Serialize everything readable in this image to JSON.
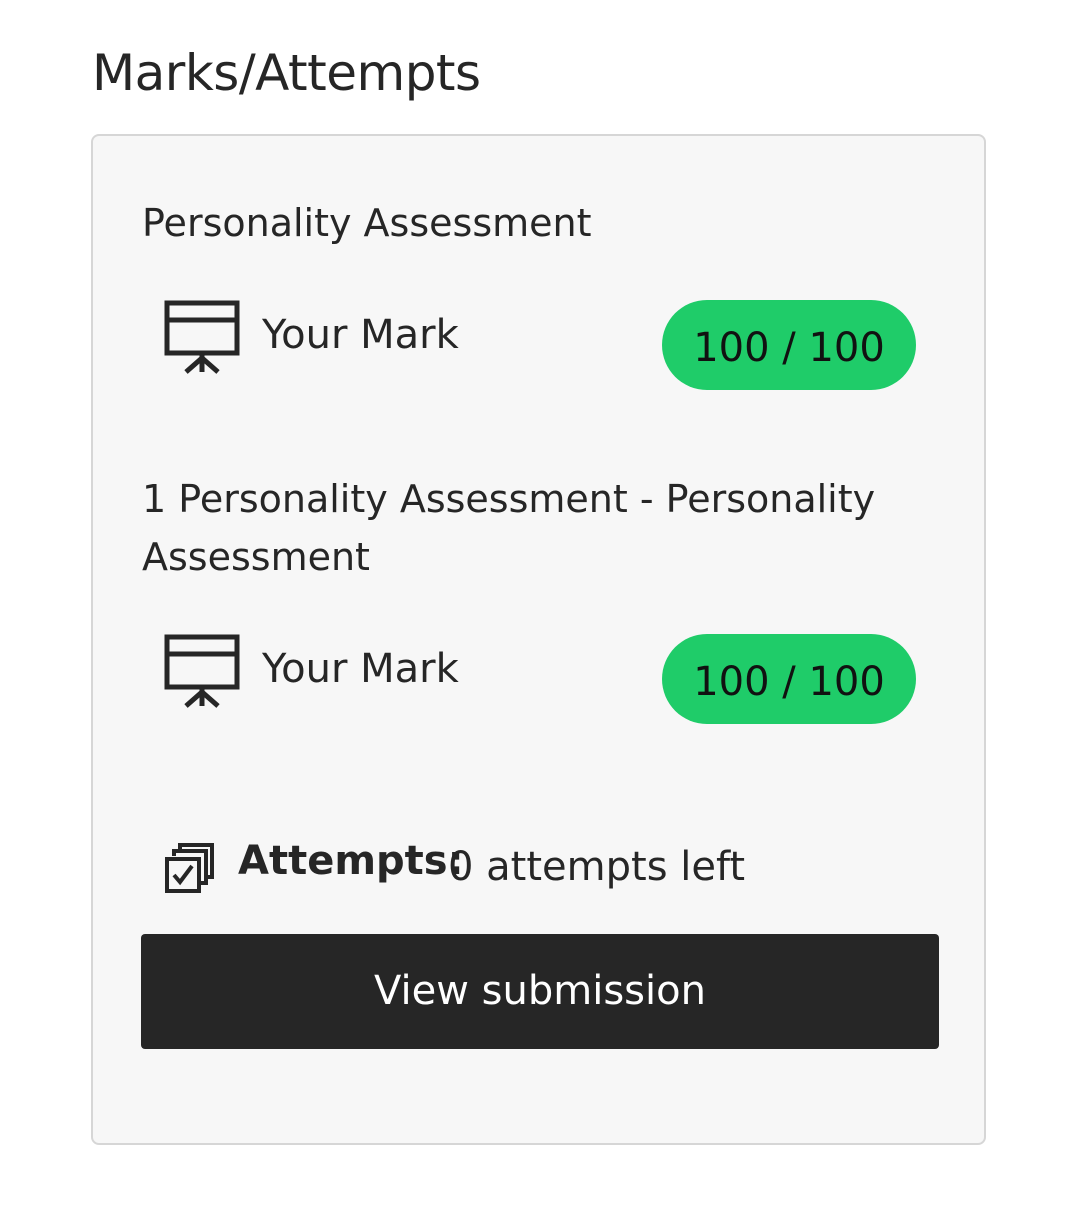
{
  "page": {
    "heading": "Marks/Attempts"
  },
  "assessments": [
    {
      "title": "Personality Assessment",
      "mark_label": "Your Mark",
      "mark_icon": "presentation-board-icon",
      "score": "100 / 100"
    },
    {
      "title": "1 Personality Assessment - Personality Assessment",
      "mark_label": "Your Mark",
      "mark_icon": "presentation-board-icon",
      "score": "100 / 100"
    }
  ],
  "attempts": {
    "icon": "multiple-checkbox-icon",
    "label": "Attempts:",
    "value": "0 attempts left"
  },
  "actions": {
    "view_submission_label": "View submission"
  },
  "colors": {
    "score_pill_bg": "#1fcc69",
    "button_bg": "#262626",
    "card_bg": "#f7f7f7",
    "card_border": "#d6d6d6",
    "text": "#262626"
  }
}
